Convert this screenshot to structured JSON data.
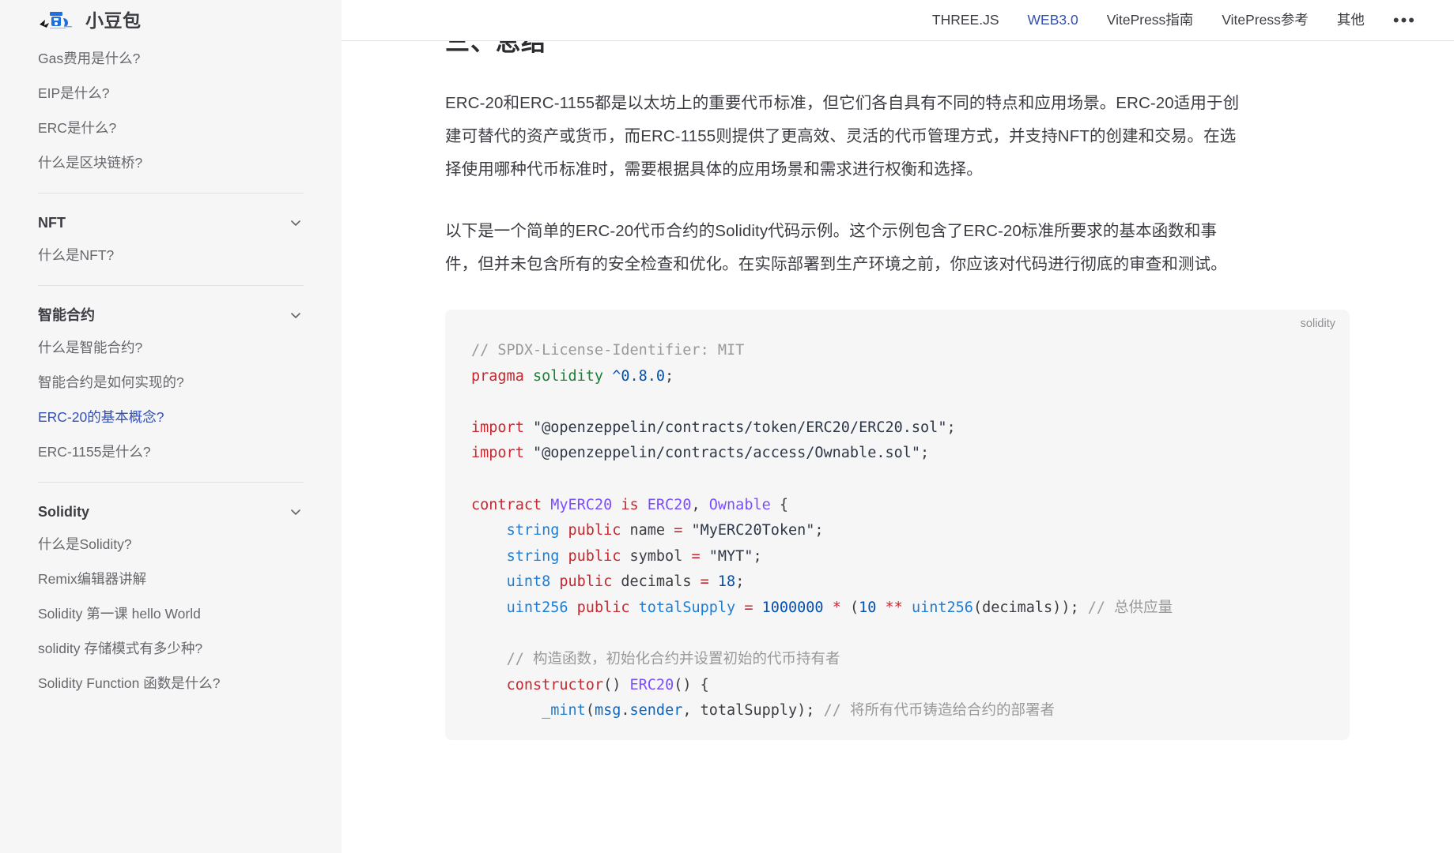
{
  "sidebar": {
    "brand": {
      "name": "小豆包",
      "logo_icon": "xiaodoubao-logo-icon"
    },
    "top_items": [
      {
        "label": "Gas费用是什么?",
        "active": false
      },
      {
        "label": "EIP是什么?",
        "active": false
      },
      {
        "label": "ERC是什么?",
        "active": false
      },
      {
        "label": "什么是区块链桥?",
        "active": false
      }
    ],
    "groups": [
      {
        "title": "NFT",
        "chevron_icon": "chevron-down-icon",
        "items": [
          {
            "label": "什么是NFT?",
            "active": false
          }
        ]
      },
      {
        "title": "智能合约",
        "chevron_icon": "chevron-down-icon",
        "items": [
          {
            "label": "什么是智能合约?",
            "active": false
          },
          {
            "label": "智能合约是如何实现的?",
            "active": false
          },
          {
            "label": "ERC-20的基本概念?",
            "active": true
          },
          {
            "label": "ERC-1155是什么?",
            "active": false
          }
        ]
      },
      {
        "title": "Solidity",
        "chevron_icon": "chevron-down-icon",
        "items": [
          {
            "label": "什么是Solidity?",
            "active": false
          },
          {
            "label": "Remix编辑器讲解",
            "active": false
          },
          {
            "label": "Solidity 第一课 hello World",
            "active": false
          },
          {
            "label": "solidity 存储模式有多少种?",
            "active": false
          },
          {
            "label": "Solidity Function 函数是什么?",
            "active": false
          }
        ]
      }
    ]
  },
  "navbar": {
    "links": [
      {
        "label": "THREE.JS",
        "active": false
      },
      {
        "label": "WEB3.0",
        "active": true
      },
      {
        "label": "VitePress指南",
        "active": false
      },
      {
        "label": "VitePress参考",
        "active": false
      },
      {
        "label": "其他",
        "active": false
      }
    ],
    "more_icon": "ellipsis-icon",
    "more_label": "•••"
  },
  "content": {
    "heading": "三、总结",
    "paragraphs": [
      "ERC-20和ERC-1155都是以太坊上的重要代币标准，但它们各自具有不同的特点和应用场景。ERC-20适用于创建可替代的资产或货币，而ERC-1155则提供了更高效、灵活的代币管理方式，并支持NFT的创建和交易。在选择使用哪种代币标准时，需要根据具体的应用场景和需求进行权衡和选择。",
      "以下是一个简单的ERC-20代币合约的Solidity代码示例。这个示例包含了ERC-20标准所要求的基本函数和事件，但并未包含所有的安全检查和优化。在实际部署到生产环境之前，你应该对代码进行彻底的审查和测试。"
    ],
    "code_block": {
      "language_label": "solidity",
      "lines": [
        "// SPDX-License-Identifier: MIT",
        "pragma solidity ^0.8.0;",
        "",
        "import \"@openzeppelin/contracts/token/ERC20/ERC20.sol\";",
        "import \"@openzeppelin/contracts/access/Ownable.sol\";",
        "",
        "contract MyERC20 is ERC20, Ownable {",
        "    string public name = \"MyERC20Token\";",
        "    string public symbol = \"MYT\";",
        "    uint8 public decimals = 18;",
        "    uint256 public totalSupply = 1000000 * (10 ** uint256(decimals)); // 总供应量",
        "",
        "    // 构造函数，初始化合约并设置初始的代币持有者",
        "    constructor() ERC20() {",
        "        _mint(msg.sender, totalSupply); // 将所有代币铸造给合约的部署者"
      ]
    }
  },
  "colors": {
    "brand": "#3451b2",
    "sidebar_bg": "#f6f6f7",
    "code_bg": "#f6f6f7",
    "text": "#3c3c43",
    "muted": "#67676c",
    "divider": "#e2e2e3"
  }
}
